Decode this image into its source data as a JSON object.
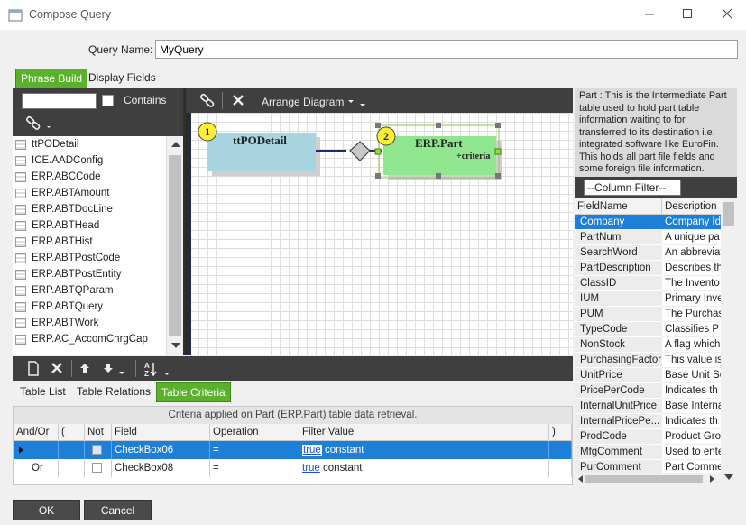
{
  "window": {
    "title": "Compose Query"
  },
  "query": {
    "name_label": "Query Name:",
    "name_value": "MyQuery"
  },
  "top_tabs": [
    {
      "label": "Phrase Build",
      "active": true
    },
    {
      "label": "Display Fields",
      "active": false
    }
  ],
  "table_list": {
    "contains_label": "Contains",
    "items": [
      "ttPODetail",
      "ICE.AADConfig",
      "ERP.ABCCode",
      "ERP.ABTAmount",
      "ERP.ABTDocLine",
      "ERP.ABTHead",
      "ERP.ABTHist",
      "ERP.ABTPostCode",
      "ERP.ABTPostEntity",
      "ERP.ABTQParam",
      "ERP.ABTQuery",
      "ERP.ABTWork",
      "ERP.AC_AccomChrgCap"
    ]
  },
  "diagram": {
    "arrange_label": "Arrange Diagram",
    "nodes": [
      {
        "badge": "1",
        "label": "ttPODetail",
        "color": "#a8d4e0"
      },
      {
        "badge": "2",
        "label": "ERP.Part",
        "sublabel": "+criteria",
        "color": "#90e68e"
      }
    ]
  },
  "description": {
    "text": "Part : This is the Intermediate Part table used to hold part table information waiting to for transferred to its destination i.e. integrated software like EuroFin. This holds all part file fields and some foreign file information."
  },
  "fields": {
    "filter_label": "--Column Filter--",
    "headers": [
      "FieldName",
      "Description"
    ],
    "rows": [
      {
        "name": "Company",
        "desc": "Company Ide",
        "selected": true
      },
      {
        "name": "PartNum",
        "desc": "A unique pa"
      },
      {
        "name": "SearchWord",
        "desc": "An abbreviat"
      },
      {
        "name": "PartDescription",
        "desc": "Describes th"
      },
      {
        "name": "ClassID",
        "desc": "The Invento"
      },
      {
        "name": "IUM",
        "desc": "Primary Inve"
      },
      {
        "name": "PUM",
        "desc": "The Purchas"
      },
      {
        "name": "TypeCode",
        "desc": "Classifies P"
      },
      {
        "name": "NonStock",
        "desc": "A flag which"
      },
      {
        "name": "PurchasingFactor",
        "desc": "This value is"
      },
      {
        "name": "UnitPrice",
        "desc": "Base Unit Se"
      },
      {
        "name": "PricePerCode",
        "desc": "Indicates th"
      },
      {
        "name": "InternalUnitPrice",
        "desc": "Base Interna"
      },
      {
        "name": "InternalPricePe...",
        "desc": "Indicates th"
      },
      {
        "name": "ProdCode",
        "desc": "Product Gro"
      },
      {
        "name": "MfgComment",
        "desc": "Used to ente"
      },
      {
        "name": "PurComment",
        "desc": "Part Comme"
      }
    ]
  },
  "bottom_tabs": [
    {
      "label": "Table List",
      "active": false
    },
    {
      "label": "Table Relations",
      "active": false
    },
    {
      "label": "Table Criteria",
      "active": true
    }
  ],
  "criteria": {
    "caption": "Criteria applied on Part (ERP.Part)  table data retrieval.",
    "columns": [
      "And/Or",
      "(",
      "Not",
      "Field",
      "Operation",
      "Filter Value",
      ")"
    ],
    "rows": [
      {
        "andor": "",
        "field": "CheckBox06",
        "op": "=",
        "fv_link": "true",
        "fv_type": "constant",
        "selected": true
      },
      {
        "andor": "Or",
        "field": "CheckBox08",
        "op": "=",
        "fv_link": "true",
        "fv_type": "constant",
        "selected": false
      }
    ]
  },
  "buttons": {
    "ok": "OK",
    "cancel": "Cancel"
  },
  "colors": {
    "accent_green": "#5ab12c",
    "selection_blue": "#1e7fd8",
    "toolbar_dark": "#3f3f3f"
  }
}
